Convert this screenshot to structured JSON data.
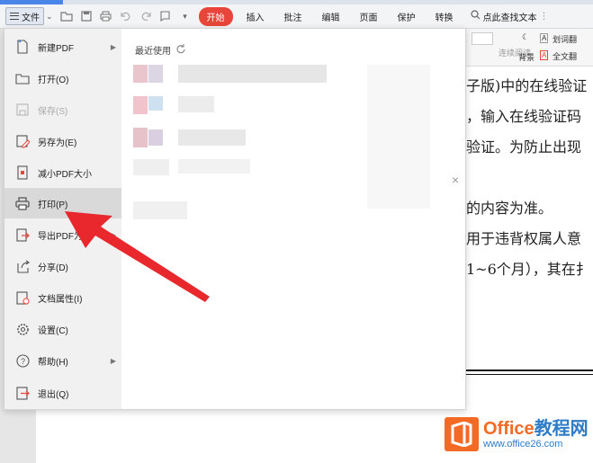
{
  "toolbar": {
    "file_label": "文件",
    "tabs": [
      "开始",
      "插入",
      "批注",
      "编辑",
      "页面",
      "保护",
      "转换"
    ],
    "search_label": "点此查找文本"
  },
  "ribbon_right": {
    "item1": "划词翻",
    "item2": "全文翻",
    "continuous": "连续阅读",
    "background": "背景"
  },
  "file_menu": {
    "items": [
      {
        "label": "新建PDF",
        "icon": "new-pdf-icon"
      },
      {
        "label": "打开(O)",
        "icon": "folder-icon"
      },
      {
        "label": "保存(S)",
        "icon": "save-icon"
      },
      {
        "label": "另存为(E)",
        "icon": "save-as-icon"
      },
      {
        "label": "减小PDF大小",
        "icon": "compress-icon"
      },
      {
        "label": "打印(P)",
        "icon": "printer-icon"
      },
      {
        "label": "导出PDF为",
        "icon": "export-icon"
      },
      {
        "label": "分享(D)",
        "icon": "share-icon"
      },
      {
        "label": "文档属性(I)",
        "icon": "properties-icon"
      },
      {
        "label": "设置(C)",
        "icon": "gear-icon"
      },
      {
        "label": "帮助(H)",
        "icon": "help-icon"
      },
      {
        "label": "退出(Q)",
        "icon": "exit-icon"
      }
    ],
    "recent_title": "最近使用"
  },
  "document": {
    "lines": [
      "子版)中的在线验证",
      "，输入在线验证码",
      "验证。为防止出现",
      "的内容为准。",
      "用于违背权属人意",
      "1~6个月），其在扌"
    ]
  },
  "watermark": {
    "brand_left": "Office",
    "brand_right": "教程网",
    "url": "www.office26.com"
  },
  "colors": {
    "accent_red": "#e8463a",
    "logo_orange": "#f36a25",
    "logo_blue": "#2e7cc7"
  }
}
